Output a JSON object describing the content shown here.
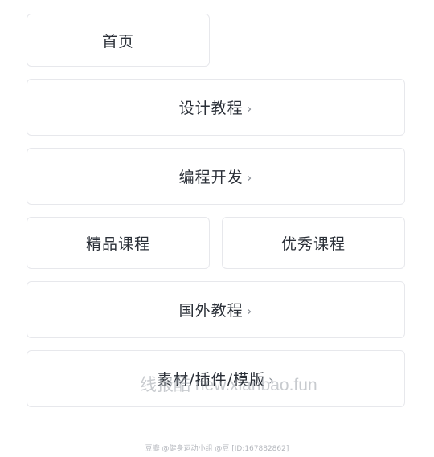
{
  "menu": {
    "home": "首页",
    "design": "设计教程",
    "coding": "编程开发",
    "premium": "精品课程",
    "excellent": "优秀课程",
    "foreign": "国外教程",
    "resources": "素材/插件/模版"
  },
  "chevron": "›",
  "watermark": "线报酷 new.xianbao.fun",
  "footer": "豆瓣 @健身运动小组 @豆 [ID:167882862]"
}
